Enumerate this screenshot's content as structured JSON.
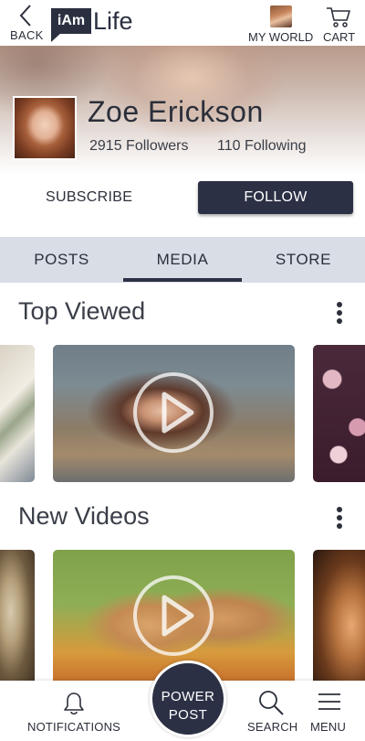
{
  "header": {
    "back_label": "BACK",
    "logo_box_text": "iAm",
    "logo_word": "Life",
    "my_world_label": "MY WORLD",
    "cart_label": "CART"
  },
  "profile": {
    "name": "Zoe Erickson",
    "followers": "2915 Followers",
    "following": "110 Following",
    "subscribe_label": "SUBSCRIBE",
    "follow_label": "FOLLOW"
  },
  "tabs": {
    "items": [
      {
        "label": "POSTS"
      },
      {
        "label": "MEDIA"
      },
      {
        "label": "STORE"
      }
    ],
    "active": "MEDIA"
  },
  "sections": [
    {
      "title": "Top Viewed"
    },
    {
      "title": "New Videos"
    }
  ],
  "bottom_nav": {
    "notifications_label": "NOTIFICATIONS",
    "power_line1": "POWER",
    "power_line2": "POST",
    "search_label": "SEARCH",
    "menu_label": "MENU"
  },
  "colors": {
    "accent": "#2b3045",
    "tab_bar": "#d9dde6",
    "text": "#2b2f3a"
  }
}
